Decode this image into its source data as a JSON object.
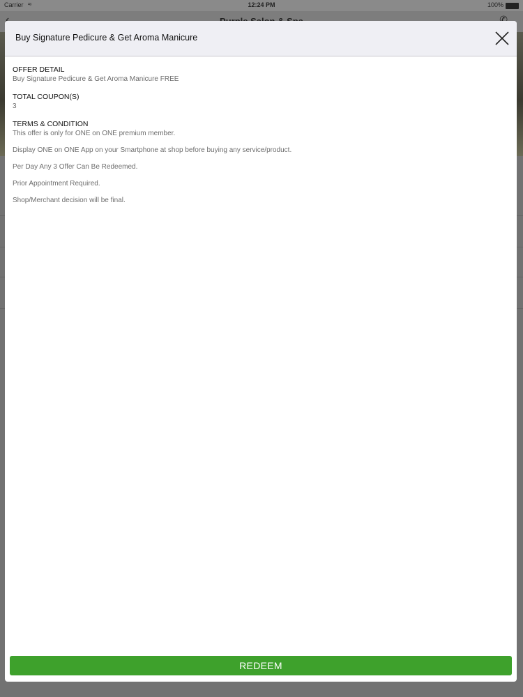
{
  "status_bar": {
    "carrier": "Carrier",
    "time": "12:24 PM",
    "battery": "100%"
  },
  "background": {
    "nav_title": "Purple Salon & Spa"
  },
  "modal": {
    "title": "Buy Signature Pedicure & Get Aroma Manicure",
    "offer_detail_label": "OFFER DETAIL",
    "offer_detail_value": "Buy Signature Pedicure & Get Aroma Manicure FREE",
    "total_coupons_label": "TOTAL COUPON(S)",
    "total_coupons_value": "3",
    "terms_label": "TERMS & CONDITION",
    "terms": [
      "This offer is only for ONE on ONE premium member.",
      "Display ONE on ONE App on your Smartphone at shop before buying any service/product.",
      "Per Day Any 3 Offer Can Be Redeemed.",
      "Prior Appointment Required.",
      "Shop/Merchant decision will be final."
    ],
    "redeem_label": "REDEEM"
  },
  "colors": {
    "accent": "#3ea12c",
    "header_bg": "#efeff4"
  },
  "icons": {
    "close": "close-icon",
    "wifi": "wifi-icon",
    "back": "chevron-left-icon",
    "call": "phone-icon"
  }
}
